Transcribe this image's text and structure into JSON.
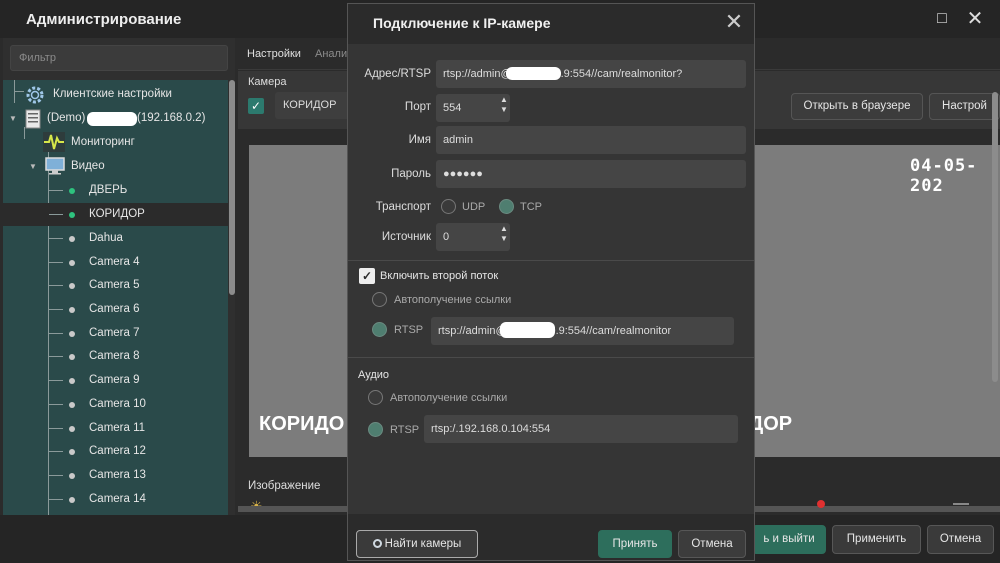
{
  "admin": {
    "title": "Администрирование",
    "maximize_icon": "□",
    "close_icon": "✕"
  },
  "sidebar": {
    "filter_placeholder": "Фильтр",
    "client_settings": "Клиентские настройки",
    "server": "(Demo)",
    "server_ip": "(192.168.0.2)",
    "monitoring": "Мониторинг",
    "video": "Видео",
    "cameras": [
      "ДВЕРЬ",
      "КОРИДОР",
      "Dahua",
      "Camera 4",
      "Camera 5",
      "Camera 6",
      "Camera 7",
      "Camera 8",
      "Camera 9",
      "Camera 10",
      "Camera 11",
      "Camera 12",
      "Camera 13",
      "Camera 14"
    ],
    "camera_status": [
      "on",
      "on",
      "off",
      "off",
      "off",
      "off",
      "off",
      "off",
      "off",
      "off",
      "off",
      "off",
      "off",
      "off"
    ],
    "selected": "КОРИДОР"
  },
  "main": {
    "tabs": [
      "Настройки",
      "Анали"
    ],
    "camera_label": "Камера",
    "camera_checked": "✓",
    "camera_name": "КОРИДОР",
    "open_browser": "Открыть в браузере",
    "settings_button": "Настрой",
    "video_timestamp": "04-05-202",
    "video_overlay_left": "КОРИДО",
    "video_overlay_right": "ДОР",
    "image_label": "Изображение",
    "sun_icon": "☀"
  },
  "footer": {
    "apply_exit": "ь и выйти",
    "apply": "Применить",
    "cancel": "Отмена"
  },
  "dialog": {
    "title": "Подключение к IP-камере",
    "close_icon": "✕",
    "address_label": "Адрес/RTSP",
    "address_value": "rtsp://admin@192.168.0.9:554//cam/realmonitor?",
    "port_label": "Порт",
    "port_value": "554",
    "name_label": "Имя",
    "name_value": "admin",
    "password_label": "Пароль",
    "password_value": "●●●●●●",
    "transport_label": "Транспорт",
    "transport_udp": "UDP",
    "transport_tcp": "TCP",
    "source_label": "Источник",
    "source_value": "0",
    "spin_up": "▲",
    "spin_down": "▼",
    "second_stream_label": "Включить второй поток",
    "second_stream_checked": "✓",
    "auto_link": "Автополучение ссылки",
    "rtsp_label": "RTSP",
    "second_rtsp_value": "rtsp://admin@192.168.0.9:554//cam/realmonitor",
    "audio_label": "Аудио",
    "audio_auto_link": "Автополучение ссылки",
    "audio_rtsp_label": "RTSP",
    "audio_rtsp_value": "rtsp:/.192.168.0.104:554",
    "find_cameras": "Найти камеры",
    "accept": "Принять",
    "cancel": "Отмена"
  }
}
